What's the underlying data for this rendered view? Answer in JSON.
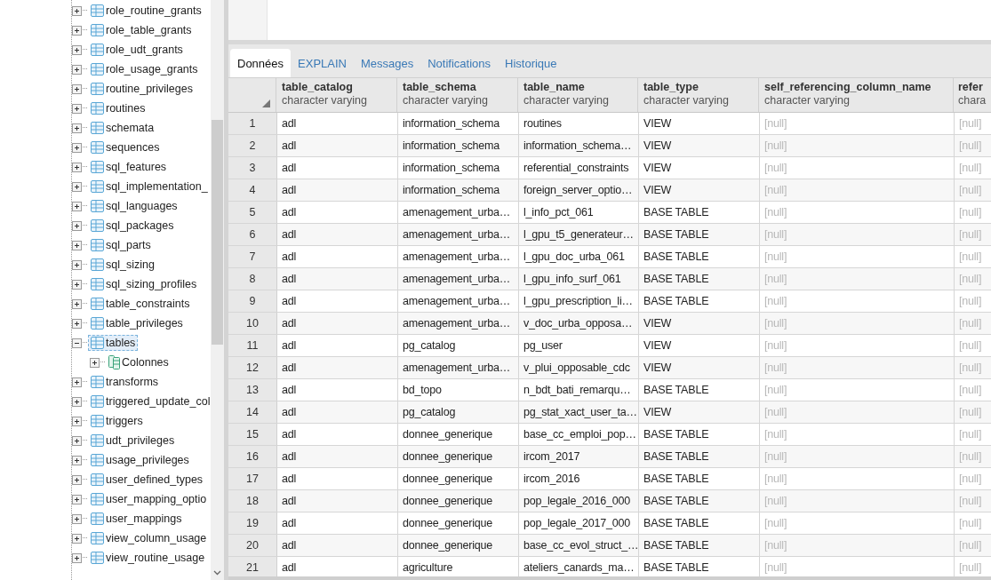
{
  "tree": {
    "items": [
      {
        "label": "role_routine_grants",
        "kind": "table",
        "expanded": false,
        "selected": false
      },
      {
        "label": "role_table_grants",
        "kind": "table",
        "expanded": false,
        "selected": false
      },
      {
        "label": "role_udt_grants",
        "kind": "table",
        "expanded": false,
        "selected": false
      },
      {
        "label": "role_usage_grants",
        "kind": "table",
        "expanded": false,
        "selected": false
      },
      {
        "label": "routine_privileges",
        "kind": "table",
        "expanded": false,
        "selected": false
      },
      {
        "label": "routines",
        "kind": "table",
        "expanded": false,
        "selected": false
      },
      {
        "label": "schemata",
        "kind": "table",
        "expanded": false,
        "selected": false
      },
      {
        "label": "sequences",
        "kind": "table",
        "expanded": false,
        "selected": false
      },
      {
        "label": "sql_features",
        "kind": "table",
        "expanded": false,
        "selected": false
      },
      {
        "label": "sql_implementation_",
        "kind": "table",
        "expanded": false,
        "selected": false
      },
      {
        "label": "sql_languages",
        "kind": "table",
        "expanded": false,
        "selected": false
      },
      {
        "label": "sql_packages",
        "kind": "table",
        "expanded": false,
        "selected": false
      },
      {
        "label": "sql_parts",
        "kind": "table",
        "expanded": false,
        "selected": false
      },
      {
        "label": "sql_sizing",
        "kind": "table",
        "expanded": false,
        "selected": false
      },
      {
        "label": "sql_sizing_profiles",
        "kind": "table",
        "expanded": false,
        "selected": false
      },
      {
        "label": "table_constraints",
        "kind": "table",
        "expanded": false,
        "selected": false
      },
      {
        "label": "table_privileges",
        "kind": "table",
        "expanded": false,
        "selected": false
      },
      {
        "label": "tables",
        "kind": "table",
        "expanded": true,
        "selected": true,
        "children": [
          {
            "label": "Colonnes",
            "kind": "columns",
            "expanded": false,
            "selected": false
          }
        ]
      },
      {
        "label": "transforms",
        "kind": "table",
        "expanded": false,
        "selected": false
      },
      {
        "label": "triggered_update_col",
        "kind": "table",
        "expanded": false,
        "selected": false
      },
      {
        "label": "triggers",
        "kind": "table",
        "expanded": false,
        "selected": false
      },
      {
        "label": "udt_privileges",
        "kind": "table",
        "expanded": false,
        "selected": false
      },
      {
        "label": "usage_privileges",
        "kind": "table",
        "expanded": false,
        "selected": false
      },
      {
        "label": "user_defined_types",
        "kind": "table",
        "expanded": false,
        "selected": false
      },
      {
        "label": "user_mapping_optio",
        "kind": "table",
        "expanded": false,
        "selected": false
      },
      {
        "label": "user_mappings",
        "kind": "table",
        "expanded": false,
        "selected": false
      },
      {
        "label": "view_column_usage",
        "kind": "table",
        "expanded": false,
        "selected": false
      },
      {
        "label": "view_routine_usage",
        "kind": "table",
        "expanded": false,
        "selected": false
      }
    ]
  },
  "tabs": [
    {
      "label": "Données",
      "selected": true
    },
    {
      "label": "EXPLAIN",
      "selected": false
    },
    {
      "label": "Messages",
      "selected": false
    },
    {
      "label": "Notifications",
      "selected": false
    },
    {
      "label": "Historique",
      "selected": false
    }
  ],
  "table": {
    "columns": [
      {
        "name": "table_catalog",
        "type": "character varying"
      },
      {
        "name": "table_schema",
        "type": "character varying"
      },
      {
        "name": "table_name",
        "type": "character varying"
      },
      {
        "name": "table_type",
        "type": "character varying"
      },
      {
        "name": "self_referencing_column_name",
        "type": "character varying"
      },
      {
        "name": "refer",
        "type": "chara"
      }
    ],
    "rows": [
      {
        "number": "1",
        "cells": [
          "adl",
          "information_schema",
          "routines",
          "VIEW",
          "[null]",
          "[null]"
        ]
      },
      {
        "number": "2",
        "cells": [
          "adl",
          "information_schema",
          "information_schema…",
          "VIEW",
          "[null]",
          "[null]"
        ]
      },
      {
        "number": "3",
        "cells": [
          "adl",
          "information_schema",
          "referential_constraints",
          "VIEW",
          "[null]",
          "[null]"
        ]
      },
      {
        "number": "4",
        "cells": [
          "adl",
          "information_schema",
          "foreign_server_optio…",
          "VIEW",
          "[null]",
          "[null]"
        ]
      },
      {
        "number": "5",
        "cells": [
          "adl",
          "amenagement_urba…",
          "l_info_pct_061",
          "BASE TABLE",
          "[null]",
          "[null]"
        ]
      },
      {
        "number": "6",
        "cells": [
          "adl",
          "amenagement_urba…",
          "l_gpu_t5_generateur…",
          "BASE TABLE",
          "[null]",
          "[null]"
        ]
      },
      {
        "number": "7",
        "cells": [
          "adl",
          "amenagement_urba…",
          "l_gpu_doc_urba_061",
          "BASE TABLE",
          "[null]",
          "[null]"
        ]
      },
      {
        "number": "8",
        "cells": [
          "adl",
          "amenagement_urba…",
          "l_gpu_info_surf_061",
          "BASE TABLE",
          "[null]",
          "[null]"
        ]
      },
      {
        "number": "9",
        "cells": [
          "adl",
          "amenagement_urba…",
          "l_gpu_prescription_li…",
          "BASE TABLE",
          "[null]",
          "[null]"
        ]
      },
      {
        "number": "10",
        "cells": [
          "adl",
          "amenagement_urba…",
          "v_doc_urba_opposa…",
          "VIEW",
          "[null]",
          "[null]"
        ]
      },
      {
        "number": "11",
        "cells": [
          "adl",
          "pg_catalog",
          "pg_user",
          "VIEW",
          "[null]",
          "[null]"
        ]
      },
      {
        "number": "12",
        "cells": [
          "adl",
          "amenagement_urba…",
          "v_plui_opposable_cdc",
          "VIEW",
          "[null]",
          "[null]"
        ]
      },
      {
        "number": "13",
        "cells": [
          "adl",
          "bd_topo",
          "n_bdt_bati_remarqu…",
          "BASE TABLE",
          "[null]",
          "[null]"
        ]
      },
      {
        "number": "14",
        "cells": [
          "adl",
          "pg_catalog",
          "pg_stat_xact_user_ta…",
          "VIEW",
          "[null]",
          "[null]"
        ]
      },
      {
        "number": "15",
        "cells": [
          "adl",
          "donnee_generique",
          "base_cc_emploi_pop…",
          "BASE TABLE",
          "[null]",
          "[null]"
        ]
      },
      {
        "number": "16",
        "cells": [
          "adl",
          "donnee_generique",
          "ircom_2017",
          "BASE TABLE",
          "[null]",
          "[null]"
        ]
      },
      {
        "number": "17",
        "cells": [
          "adl",
          "donnee_generique",
          "ircom_2016",
          "BASE TABLE",
          "[null]",
          "[null]"
        ]
      },
      {
        "number": "18",
        "cells": [
          "adl",
          "donnee_generique",
          "pop_legale_2016_000",
          "BASE TABLE",
          "[null]",
          "[null]"
        ]
      },
      {
        "number": "19",
        "cells": [
          "adl",
          "donnee_generique",
          "pop_legale_2017_000",
          "BASE TABLE",
          "[null]",
          "[null]"
        ]
      },
      {
        "number": "20",
        "cells": [
          "adl",
          "donnee_generique",
          "base_cc_evol_struct_…",
          "BASE TABLE",
          "[null]",
          "[null]"
        ]
      },
      {
        "number": "21",
        "cells": [
          "adl",
          "agriculture",
          "ateliers_canards_ma…",
          "BASE TABLE",
          "[null]",
          "[null]"
        ]
      }
    ]
  }
}
